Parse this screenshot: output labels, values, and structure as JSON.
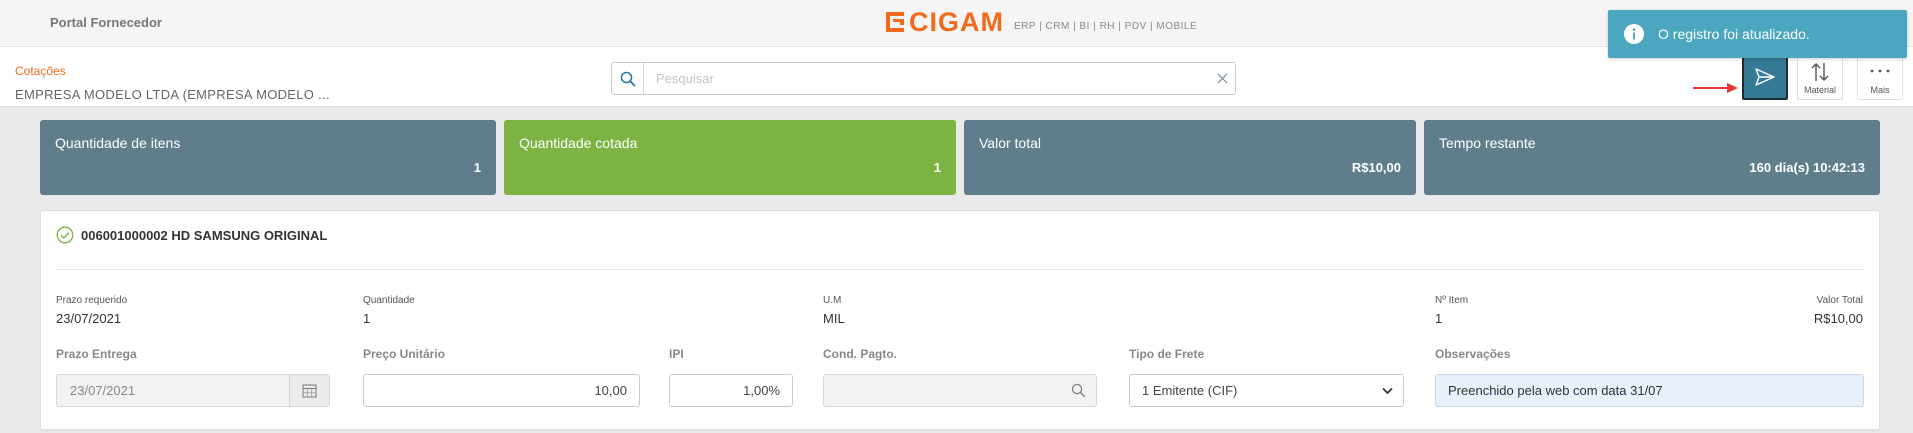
{
  "header": {
    "portal_title": "Portal Fornecedor",
    "logo_text": "CIGAM",
    "logo_tagline": "ERP | CRM | BI | RH | PDV | MOBILE"
  },
  "subheader": {
    "breadcrumb": "Cotações",
    "company": "EMPRESA MODELO LTDA (EMPRESA MODELO ...",
    "search_placeholder": "Pesquisar",
    "search_value": ""
  },
  "toolbar": {
    "material_label": "Material",
    "more_label": "Mais"
  },
  "toast": {
    "message": "O registro foi atualizado."
  },
  "cards": [
    {
      "label": "Quantidade de itens",
      "value": "1"
    },
    {
      "label": "Quantidade cotada",
      "value": "1"
    },
    {
      "label": "Valor total",
      "value": "R$10,00"
    },
    {
      "label": "Tempo restante",
      "value": "160 dia(s) 10:42:13"
    }
  ],
  "item": {
    "title": "006001000002 HD SAMSUNG ORIGINAL",
    "info": {
      "prazo_requerido_label": "Prazo requerido",
      "prazo_requerido": "23/07/2021",
      "quantidade_label": "Quantidade",
      "quantidade": "1",
      "um_label": "U.M",
      "um": "MIL",
      "nr_item_label": "Nº Item",
      "nr_item": "1",
      "valor_total_label": "Valor Total",
      "valor_total": "R$10,00"
    },
    "form": {
      "prazo_entrega_label": "Prazo Entrega",
      "prazo_entrega": "23/07/2021",
      "preco_unitario_label": "Preço Unitário",
      "preco_unitario": "10,00",
      "ipi_label": "IPI",
      "ipi": "1,00%",
      "cond_pagto_label": "Cond. Pagto.",
      "cond_pagto": "",
      "tipo_frete_label": "Tipo de Frete",
      "tipo_frete": "1 Emitente (CIF)",
      "observacoes_label": "Observações",
      "observacoes": "Preenchido pela web com data 31/07"
    }
  },
  "colors": {
    "accent_orange": "#f26b1d",
    "card_gray": "#607d8b",
    "card_green": "#7cb342",
    "send_button": "#357a94",
    "toast": "#4aa7bf",
    "arrow_red": "#e53935"
  }
}
